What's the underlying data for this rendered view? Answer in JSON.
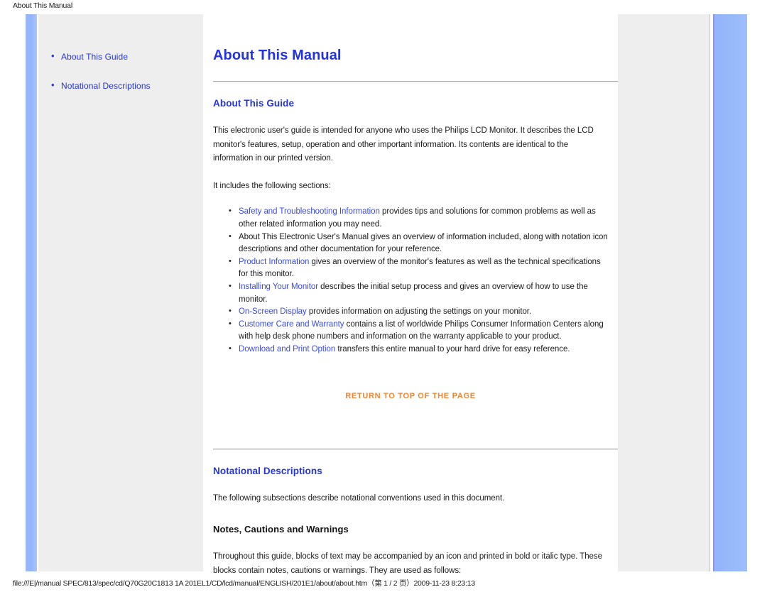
{
  "print": {
    "header": "About This Manual",
    "footer": "file:///E|/manual SPEC/813/spec/cd/Q70G20C1813 1A 201EL1/CD/lcd/manual/ENGLISH/201E1/about/about.htm（第 1 / 2 页）2009-11-23 8:23:13"
  },
  "colors": {
    "link_blue": "#2433e0",
    "inline_link_blue": "#3a4ae8",
    "return_top_orange": "#f2832f",
    "panel_gray": "#eeeeee",
    "bar_blue": "#93b3fb",
    "rule_gray": "#a6a6a6"
  },
  "sidebar": {
    "bullet": "•",
    "items": [
      {
        "label": "About This Guide"
      },
      {
        "label": "Notational Descriptions"
      }
    ]
  },
  "main": {
    "title": "About This Manual",
    "section_guide": {
      "heading": "About This Guide",
      "intro": "This electronic user's guide is intended for anyone who uses the Philips LCD Monitor. It describes the LCD monitor's features, setup, operation and other important information. Its contents are identical to the information in our printed version.",
      "includes_label": "It includes the following sections:",
      "items": [
        {
          "link": "Safety and Troubleshooting Information",
          "text": " provides tips and solutions for common problems as well as other related information you may need."
        },
        {
          "link": "",
          "text": "About This Electronic User's Manual gives an overview of information included, along with notation icon descriptions and other documentation for your reference."
        },
        {
          "link": "Product Information",
          "text": " gives an overview of the monitor's features as well as the technical specifications for this monitor."
        },
        {
          "link": "Installing Your Monitor",
          "text": " describes the initial setup process and gives an overview of how to use the monitor."
        },
        {
          "link": "On-Screen Display",
          "text": " provides information on adjusting the settings on your monitor."
        },
        {
          "link": "Customer Care and Warranty",
          "text": " contains a list of worldwide Philips Consumer Information Centers along with help desk phone numbers and information on the warranty applicable to your product."
        },
        {
          "link": "Download and Print Option",
          "text": " transfers this entire manual to your hard drive for easy reference."
        }
      ],
      "return_top": "RETURN TO TOP OF THE PAGE"
    },
    "section_notational": {
      "heading": "Notational Descriptions",
      "intro": "The following subsections describe notational conventions used in this document.",
      "sub_heading": "Notes, Cautions and Warnings",
      "body": "Throughout this guide, blocks of text may be accompanied by an icon and printed in bold or italic type. These blocks contain notes, cautions or warnings. They are used as follows:"
    }
  }
}
